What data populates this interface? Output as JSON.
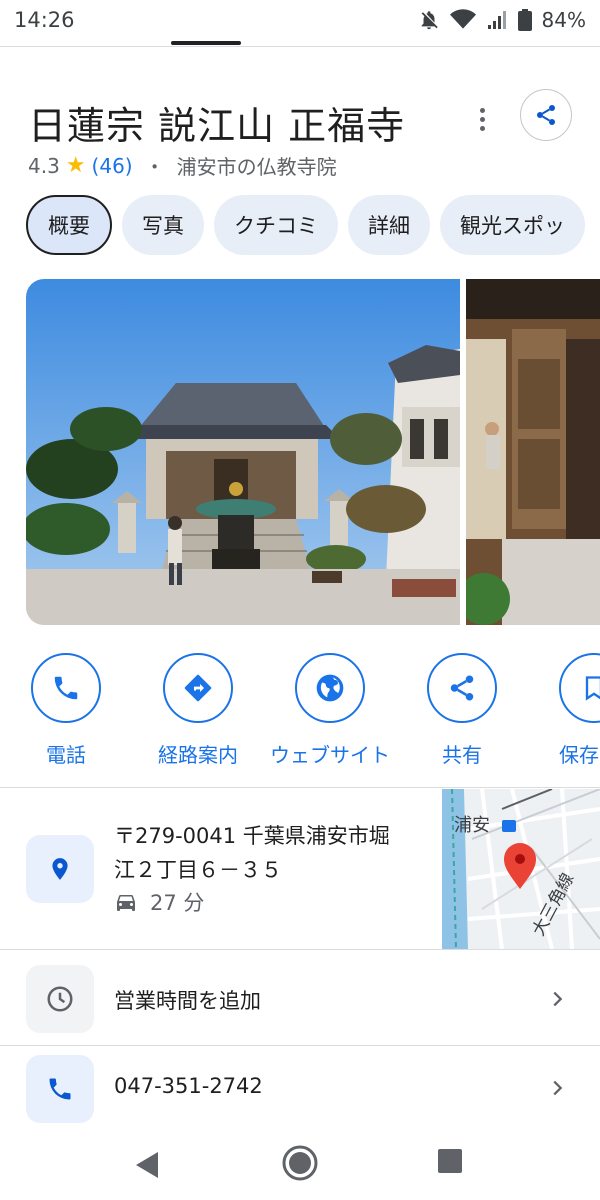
{
  "status": {
    "time": "14:26",
    "battery": "84%"
  },
  "place": {
    "title": "日蓮宗 説江山 正福寺",
    "rating": "4.3",
    "reviews": "(46)",
    "separator": "・",
    "category": "浦安市の仏教寺院"
  },
  "tabs": [
    {
      "label": "概要",
      "active": true
    },
    {
      "label": "写真"
    },
    {
      "label": "クチコミ"
    },
    {
      "label": "詳細"
    },
    {
      "label": "観光スポッ"
    }
  ],
  "actions": [
    {
      "label": "電話",
      "icon": "phone-icon"
    },
    {
      "label": "経路案内",
      "icon": "directions-icon"
    },
    {
      "label": "ウェブサイト",
      "icon": "globe-icon"
    },
    {
      "label": "共有",
      "icon": "share-icon"
    },
    {
      "label": "保存",
      "icon": "bookmark-icon"
    }
  ],
  "address": {
    "line1": "〒279-0041 千葉県浦安市堀",
    "line2": "江２丁目６－３５",
    "drive_time": "27 分"
  },
  "map": {
    "station": "浦安",
    "road": "大三角線"
  },
  "hours": {
    "label": "営業時間を追加"
  },
  "phone": {
    "number": "047-351-2742"
  },
  "colors": {
    "accent": "#1a73e8",
    "chip_bg": "#e8eef8",
    "icon_box": "#e8f0fe",
    "pin": "#ea4335"
  }
}
